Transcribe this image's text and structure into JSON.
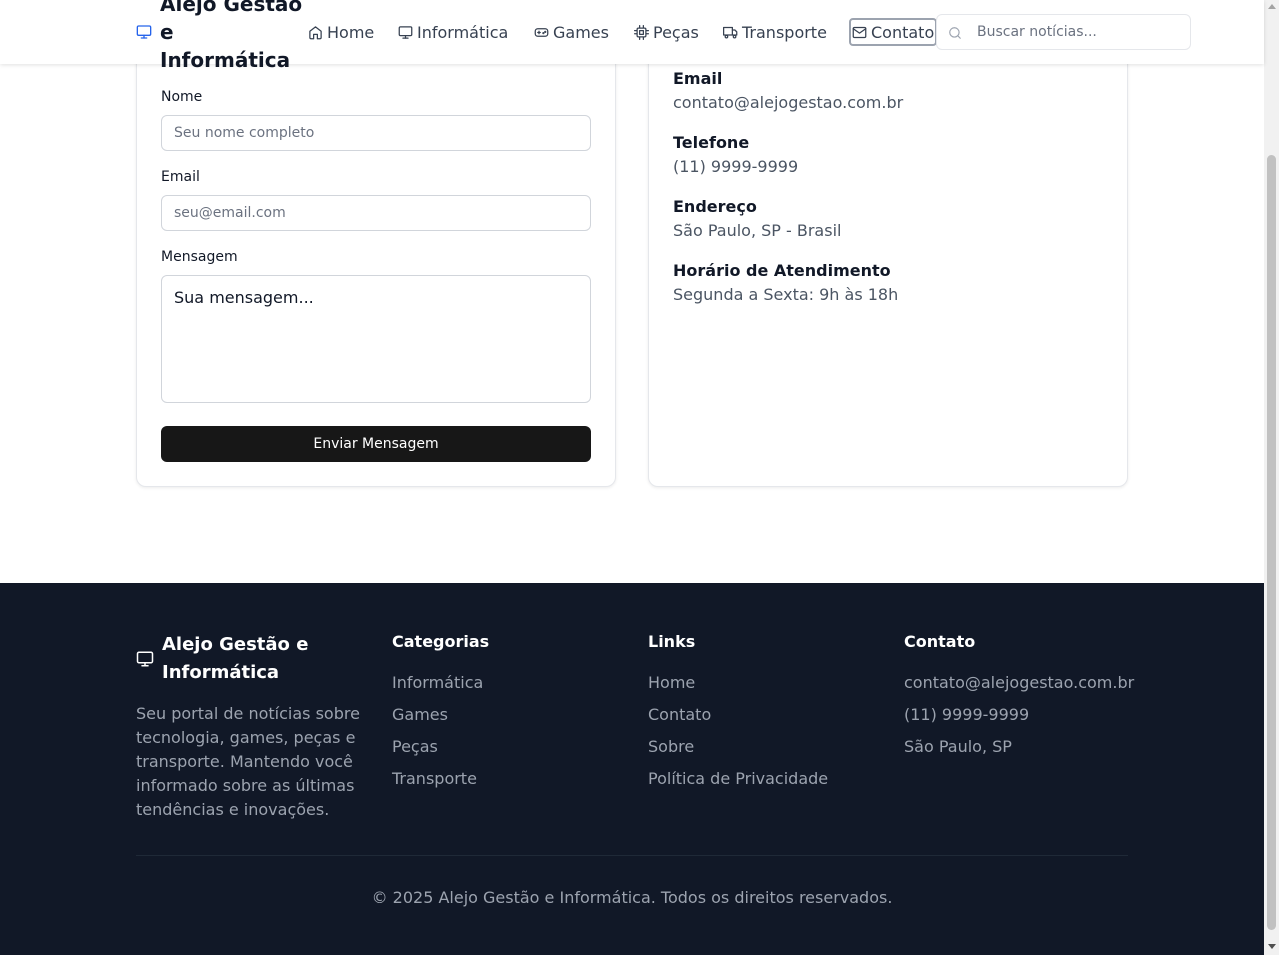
{
  "header": {
    "brand": "Alejo Gestão e Informática",
    "nav": [
      {
        "label": "Home",
        "icon": "home-icon"
      },
      {
        "label": "Informática",
        "icon": "monitor-icon"
      },
      {
        "label": "Games",
        "icon": "gamepad-icon"
      },
      {
        "label": "Peças",
        "icon": "cpu-icon"
      },
      {
        "label": "Transporte",
        "icon": "truck-icon"
      },
      {
        "label": "Contato",
        "icon": "mail-icon",
        "active": true
      }
    ],
    "search": {
      "placeholder": "Buscar notícias..."
    }
  },
  "form": {
    "name_label": "Nome",
    "name_placeholder": "Seu nome completo",
    "email_label": "Email",
    "email_placeholder": "seu@email.com",
    "message_label": "Mensagem",
    "message_placeholder": "Sua mensagem...",
    "submit_label": "Enviar Mensagem"
  },
  "contact_info": {
    "email_title": "Email",
    "email_value": "contato@alejogestao.com.br",
    "phone_title": "Telefone",
    "phone_value": "(11) 9999-9999",
    "address_title": "Endereço",
    "address_value": "São Paulo, SP - Brasil",
    "hours_title": "Horário de Atendimento",
    "hours_value": "Segunda a Sexta: 9h às 18h"
  },
  "footer": {
    "brand": "Alejo Gestão e Informática",
    "description": "Seu portal de notícias sobre tecnologia, games, peças e transporte. Mantendo você informado sobre as últimas tendências e inovações.",
    "categories": {
      "title": "Categorias",
      "items": [
        "Informática",
        "Games",
        "Peças",
        "Transporte"
      ]
    },
    "links": {
      "title": "Links",
      "items": [
        "Home",
        "Contato",
        "Sobre",
        "Política de Privacidade"
      ]
    },
    "contact": {
      "title": "Contato",
      "items": [
        "contato@alejogestao.com.br",
        "(11) 9999-9999",
        "São Paulo, SP"
      ]
    },
    "copyright": "© 2025 Alejo Gestão e Informática. Todos os direitos reservados."
  },
  "colors": {
    "brand_accent": "#2563eb",
    "footer_bg": "#111827",
    "button_bg": "#171717"
  }
}
